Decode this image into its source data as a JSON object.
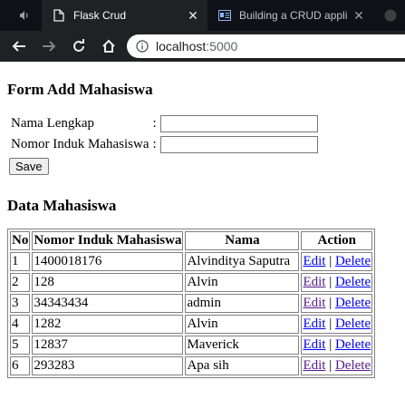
{
  "browser": {
    "tabs": [
      {
        "title": "Flask Crud",
        "active": true
      },
      {
        "title": "Building a CRUD appli",
        "active": false
      }
    ],
    "url_host": "localhost",
    "url_port": ":5000"
  },
  "form": {
    "heading": "Form Add Mahasiswa",
    "fields": [
      {
        "label": "Nama Lengkap",
        "colon": ":",
        "value": ""
      },
      {
        "label": "Nomor Induk Mahasiswa",
        "colon": ":",
        "value": ""
      }
    ],
    "save_label": "Save"
  },
  "data": {
    "heading": "Data Mahasiswa",
    "columns": [
      "No",
      "Nomor Induk Mahasiswa",
      "Nama",
      "Action"
    ],
    "rows": [
      {
        "no": "1",
        "nim": "1400018176",
        "nama": "Alvinditya Saputra",
        "edit": "Edit",
        "sep": "|",
        "delete": "Delete"
      },
      {
        "no": "2",
        "nim": "128",
        "nama": "Alvin",
        "edit": "Edit",
        "sep": "|",
        "delete": "Delete"
      },
      {
        "no": "3",
        "nim": "34343434",
        "nama": "admin",
        "edit": "Edit",
        "sep": "|",
        "delete": "Delete"
      },
      {
        "no": "4",
        "nim": "1282",
        "nama": "Alvin",
        "edit": "Edit",
        "sep": "|",
        "delete": "Delete"
      },
      {
        "no": "5",
        "nim": "12837",
        "nama": "Maverick",
        "edit": "Edit",
        "sep": "|",
        "delete": "Delete"
      },
      {
        "no": "6",
        "nim": "293283",
        "nama": "Apa sih",
        "edit": "Edit",
        "sep": "|",
        "delete": "Delete"
      }
    ]
  },
  "colors": {
    "link": "#0000ee",
    "visited_link": "#551a8b",
    "chrome_dark": "#202124"
  }
}
